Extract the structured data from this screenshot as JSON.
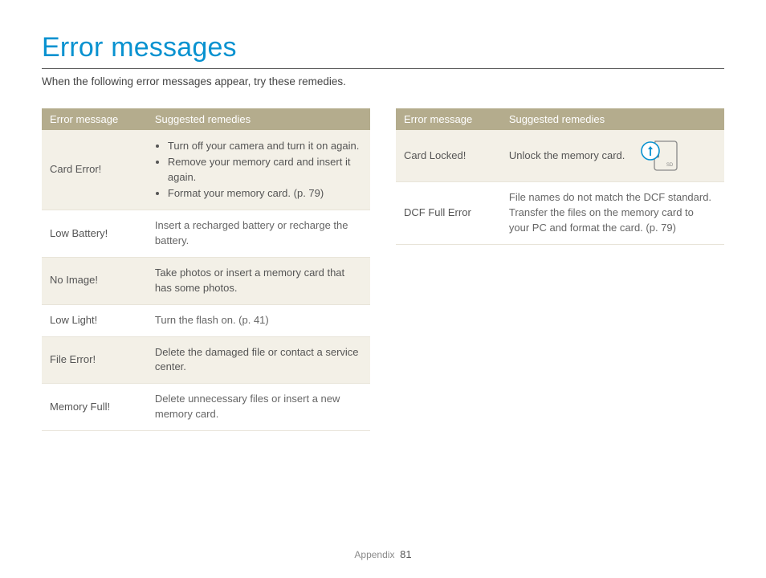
{
  "title": "Error messages",
  "intro": "When the following error messages appear, try these remedies.",
  "headers": {
    "error": "Error message",
    "remedy": "Suggested remedies"
  },
  "left": [
    {
      "error": "Card Error!",
      "remedy_list": [
        "Turn off your camera and turn it on again.",
        "Remove your memory card and insert it again.",
        "Format your memory card. (p. 79)"
      ]
    },
    {
      "error": "Low Battery!",
      "remedy": "Insert a recharged battery or recharge the battery."
    },
    {
      "error": "No Image!",
      "remedy": "Take photos or insert a memory card that has some photos."
    },
    {
      "error": "Low Light!",
      "remedy": "Turn the flash on. (p. 41)"
    },
    {
      "error": "File Error!",
      "remedy": "Delete the damaged file or contact a service center."
    },
    {
      "error": "Memory Full!",
      "remedy": "Delete unnecessary files or insert a new memory card."
    }
  ],
  "right": [
    {
      "error": "Card Locked!",
      "remedy": "Unlock the memory card.",
      "icon": true,
      "sd_label": "SD"
    },
    {
      "error": "DCF Full Error",
      "remedy": "File names do not match the DCF standard. Transfer the files on the memory card to your PC and format the card. (p. 79)"
    }
  ],
  "footer": {
    "section": "Appendix",
    "page": "81"
  }
}
